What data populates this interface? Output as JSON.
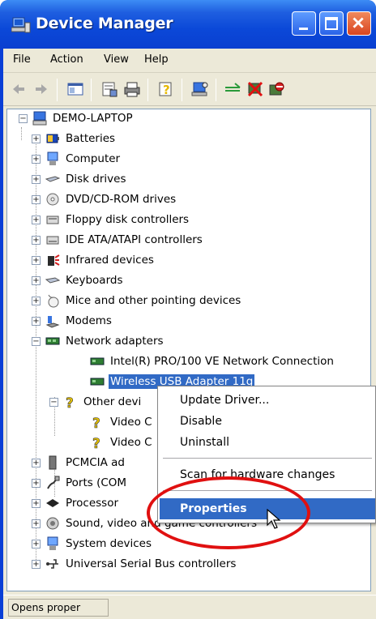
{
  "window": {
    "title": "Device Manager",
    "title_icon": "device-manager-icon"
  },
  "menubar": {
    "items": [
      "File",
      "Action",
      "View",
      "Help"
    ]
  },
  "toolbar": {
    "buttons": [
      "back-icon",
      "forward-icon",
      "show-hide-console-tree-icon",
      "properties-icon",
      "print-icon",
      "help-icon",
      "scan-hardware-icon",
      "update-driver-icon",
      "uninstall-icon",
      "disable-icon"
    ]
  },
  "tree": {
    "root": "DEMO-LAPTOP",
    "categories": [
      {
        "label": "Batteries",
        "icon": "battery-icon"
      },
      {
        "label": "Computer",
        "icon": "computer-icon"
      },
      {
        "label": "Disk drives",
        "icon": "disk-drive-icon"
      },
      {
        "label": "DVD/CD-ROM drives",
        "icon": "cdrom-icon"
      },
      {
        "label": "Floppy disk controllers",
        "icon": "floppy-controller-icon"
      },
      {
        "label": "IDE ATA/ATAPI controllers",
        "icon": "ide-controller-icon"
      },
      {
        "label": "Infrared devices",
        "icon": "infrared-icon"
      },
      {
        "label": "Keyboards",
        "icon": "keyboard-icon"
      },
      {
        "label": "Mice and other pointing devices",
        "icon": "mouse-icon"
      },
      {
        "label": "Modems",
        "icon": "modem-icon"
      },
      {
        "label": "Network adapters",
        "icon": "network-adapter-icon"
      },
      {
        "label": "Intel(R) PRO/100 VE Network Connection",
        "icon": "network-card-icon"
      },
      {
        "label": "Wireless USB Adapter 11g",
        "icon": "network-card-icon"
      },
      {
        "label": "Other devi",
        "icon": "unknown-device-icon"
      },
      {
        "label": "Video C",
        "icon": "unknown-device-icon"
      },
      {
        "label": "Video C",
        "icon": "unknown-device-icon"
      },
      {
        "label": "PCMCIA ad",
        "icon": "pcmcia-icon"
      },
      {
        "label": "Ports (COM",
        "icon": "ports-icon"
      },
      {
        "label": "Processor",
        "icon": "processor-icon"
      },
      {
        "label": "Sound, video and game controllers",
        "icon": "sound-icon"
      },
      {
        "label": "System devices",
        "icon": "system-devices-icon"
      },
      {
        "label": "Universal Serial Bus controllers",
        "icon": "usb-icon"
      }
    ]
  },
  "context_menu": {
    "items": [
      "Update Driver...",
      "Disable",
      "Uninstall",
      "Scan for hardware changes",
      "Properties"
    ],
    "highlighted": "Properties"
  },
  "statusbar": {
    "text": "Opens proper"
  },
  "colors": {
    "titlebar": "#0a3fd6",
    "selection": "#316ac5",
    "annotation_ring": "#e01010"
  }
}
